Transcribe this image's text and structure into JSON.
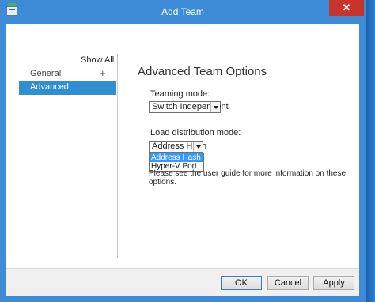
{
  "window": {
    "title": "Add Team",
    "close_glyph": "✕"
  },
  "sidebar": {
    "show_all": "Show All",
    "items": [
      {
        "label": "General",
        "expand_glyph": "+"
      },
      {
        "label": "Advanced"
      }
    ]
  },
  "main": {
    "heading": "Advanced Team Options",
    "teaming_mode": {
      "label": "Teaming mode:",
      "value": "Switch Independent"
    },
    "load_distribution": {
      "label": "Load distribution mode:",
      "value": "Address Hash",
      "options": [
        "Address Hash",
        "Hyper-V Port"
      ]
    },
    "info_text": "Please see the user guide for more information on these options."
  },
  "footer": {
    "ok": "OK",
    "cancel": "Cancel",
    "apply": "Apply"
  },
  "colors": {
    "titlebar": "#3e8bd8",
    "selection": "#2f8fd0",
    "close": "#c7342b"
  }
}
